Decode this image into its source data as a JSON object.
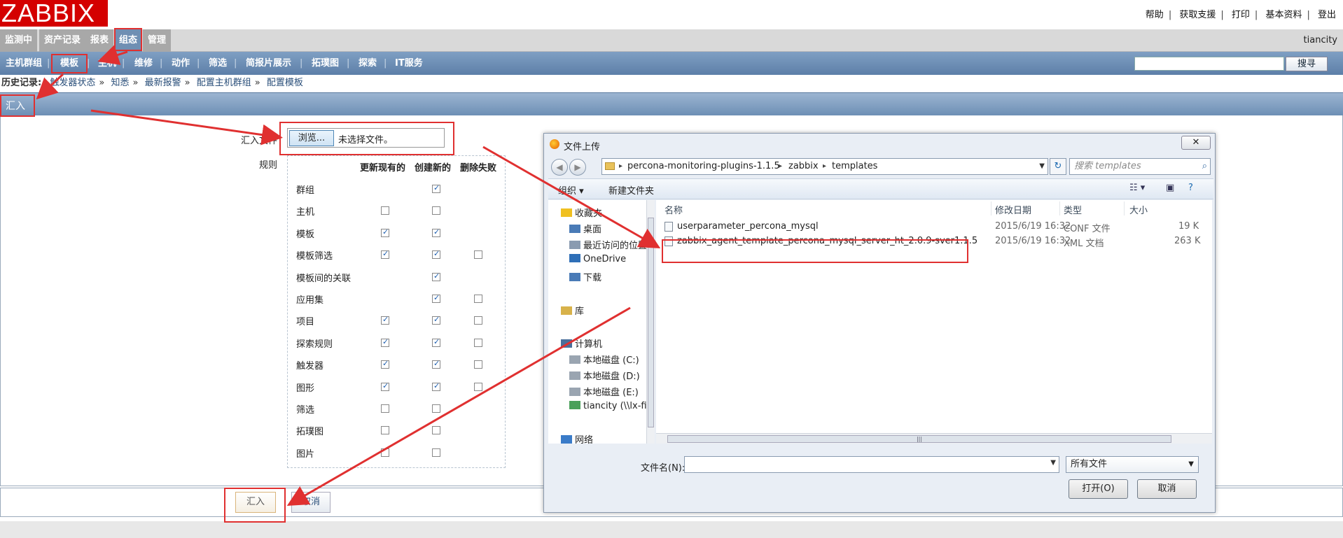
{
  "logo": "ZABBIX",
  "toplinks": [
    "帮助",
    "获取支援",
    "打印",
    "基本资料",
    "登出"
  ],
  "username": "tiancity",
  "mainmenu": [
    "监测中",
    "资产记录",
    "报表",
    "组态",
    "管理"
  ],
  "submenu": [
    "主机群组",
    "模板",
    "主机",
    "维修",
    "动作",
    "筛选",
    "简报片展示",
    "拓璞图",
    "探索",
    "IT服务"
  ],
  "search": {
    "button": "搜寻",
    "value": ""
  },
  "history": {
    "label": "历史记录:",
    "items": [
      "触发器状态",
      "知悉",
      "最新报警",
      "配置主机群组",
      "配置模板"
    ]
  },
  "page_title": "汇入",
  "form": {
    "file_label": "汇入文件",
    "browse": "浏览...",
    "no_file": "未选择文件。",
    "rules_label": "规则",
    "col_update": "更新现有的",
    "col_create": "创建新的",
    "col_delete": "删除失败",
    "rows": [
      {
        "name": "群组",
        "update": null,
        "create": true,
        "delete": null
      },
      {
        "name": "主机",
        "update": false,
        "create": false,
        "delete": null
      },
      {
        "name": "模板",
        "update": true,
        "create": true,
        "delete": null
      },
      {
        "name": "模板筛选",
        "update": true,
        "create": true,
        "delete": false
      },
      {
        "name": "模板间的关联",
        "update": null,
        "create": true,
        "delete": null
      },
      {
        "name": "应用集",
        "update": null,
        "create": true,
        "delete": false
      },
      {
        "name": "项目",
        "update": true,
        "create": true,
        "delete": false
      },
      {
        "name": "探索规则",
        "update": true,
        "create": true,
        "delete": false
      },
      {
        "name": "触发器",
        "update": true,
        "create": true,
        "delete": false
      },
      {
        "name": "图形",
        "update": true,
        "create": true,
        "delete": false
      },
      {
        "name": "筛选",
        "update": false,
        "create": false,
        "delete": null
      },
      {
        "name": "拓璞图",
        "update": false,
        "create": false,
        "delete": null
      },
      {
        "name": "图片",
        "update": false,
        "create": false,
        "delete": null
      }
    ],
    "import_button": "汇入",
    "cancel_button": "取消"
  },
  "dialog": {
    "title": "文件上传",
    "close": "✕",
    "path": [
      "percona-monitoring-plugins-1.1.5",
      "zabbix",
      "templates"
    ],
    "search_placeholder": "搜索 templates",
    "organize": "组织 ▾",
    "new_folder": "新建文件夹",
    "nav": [
      {
        "label": "收藏夹",
        "icon": "star-icon"
      },
      {
        "label": "桌面",
        "icon": "desktop-icon"
      },
      {
        "label": "最近访问的位置",
        "icon": "recent-icon"
      },
      {
        "label": "OneDrive",
        "icon": "cloud-icon"
      },
      {
        "label": "下载",
        "icon": "download-icon"
      },
      {
        "label": "库",
        "icon": "library-icon"
      },
      {
        "label": "计算机",
        "icon": "computer-icon"
      },
      {
        "label": "本地磁盘 (C:)",
        "icon": "disk-icon"
      },
      {
        "label": "本地磁盘 (D:)",
        "icon": "disk-icon"
      },
      {
        "label": "本地磁盘 (E:)",
        "icon": "disk-icon"
      },
      {
        "label": "tiancity (\\\\lx-file",
        "icon": "network-drive-icon"
      },
      {
        "label": "网络",
        "icon": "network-icon"
      }
    ],
    "columns": [
      "名称",
      "修改日期",
      "类型",
      "大小"
    ],
    "files": [
      {
        "name": "userparameter_percona_mysql",
        "date": "2015/6/19 16:32",
        "type": "CONF 文件",
        "size": "19 K"
      },
      {
        "name": "zabbix_agent_template_percona_mysql_server_ht_2.0.9-sver1.1.5",
        "date": "2015/6/19 16:32",
        "type": "XML 文档",
        "size": "263 K"
      }
    ],
    "filename_label": "文件名(N):",
    "filename_value": "",
    "filetype": "所有文件",
    "open": "打开(O)",
    "cancel": "取消"
  },
  "colors": {
    "annotation": "#e03030",
    "header_blue": "#5d7fa8",
    "logo_red": "#d40000"
  }
}
